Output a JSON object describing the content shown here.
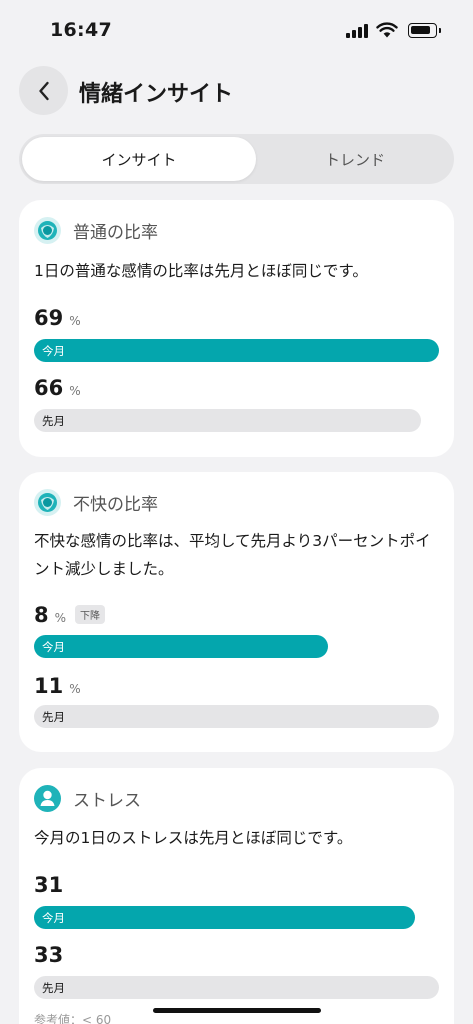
{
  "status_bar": {
    "time": "16:47"
  },
  "header": {
    "title": "情緒インサイト"
  },
  "tabs": [
    {
      "label": "インサイト",
      "active": true
    },
    {
      "label": "トレンド",
      "active": false
    }
  ],
  "accent_color": "#04a6ad",
  "cards": [
    {
      "title": "普通の比率",
      "icon": "emotion-ring-icon",
      "description": "1日の普通な感情の比率は先月とほぼ同じです。",
      "current": {
        "value": "69",
        "unit": "%",
        "label": "今月",
        "fraction": 1.0
      },
      "previous": {
        "value": "66",
        "unit": "%",
        "label": "先月",
        "fraction": 0.956
      }
    },
    {
      "title": "不快の比率",
      "icon": "emotion-ring-icon",
      "description": "不快な感情の比率は、平均して先月より3パーセントポイント減少しました。",
      "current": {
        "value": "8",
        "unit": "%",
        "label": "今月",
        "badge": "下降",
        "fraction": 0.727
      },
      "previous": {
        "value": "11",
        "unit": "%",
        "label": "先月",
        "fraction": 1.0
      }
    },
    {
      "title": "ストレス",
      "icon": "person-stress-icon",
      "description": "今月の1日のストレスは先月とほぼ同じです。",
      "current": {
        "value": "31",
        "label": "今月",
        "fraction": 0.94
      },
      "previous": {
        "value": "33",
        "label": "先月",
        "fraction": 1.0
      },
      "reference": "参考値：< 60"
    }
  ]
}
